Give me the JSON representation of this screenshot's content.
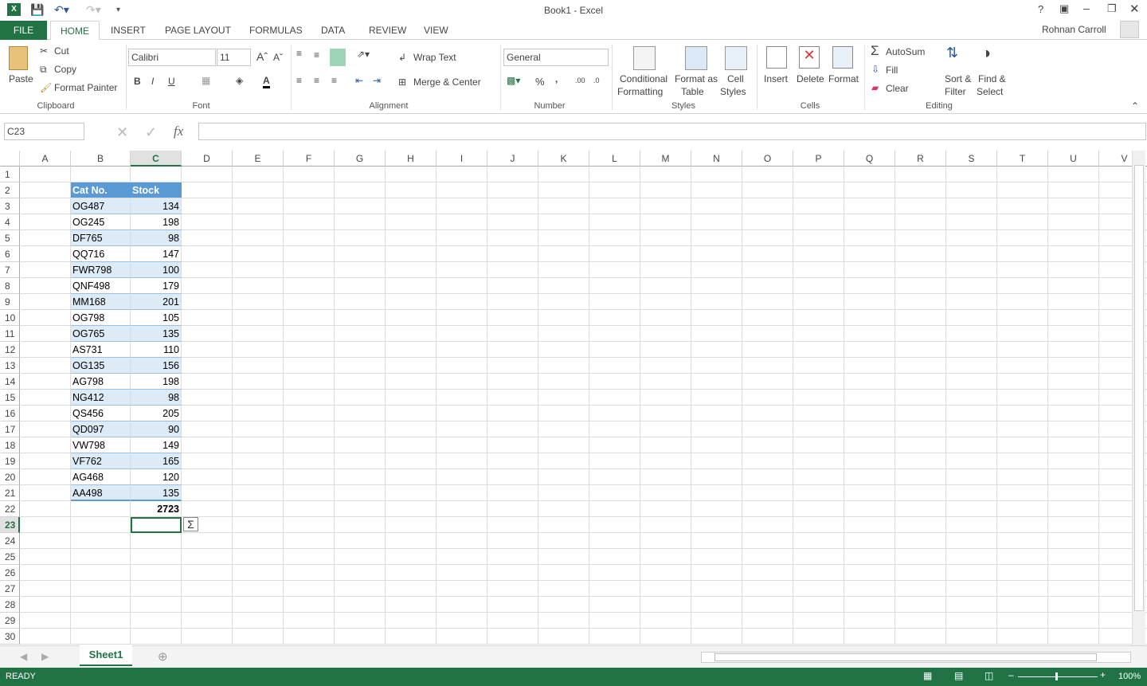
{
  "window": {
    "title": "Book1 - Excel",
    "user": "Rohnan Carroll",
    "help": "?"
  },
  "tabs": [
    {
      "label": "FILE"
    },
    {
      "label": "HOME"
    },
    {
      "label": "INSERT"
    },
    {
      "label": "PAGE LAYOUT"
    },
    {
      "label": "FORMULAS"
    },
    {
      "label": "DATA"
    },
    {
      "label": "REVIEW"
    },
    {
      "label": "VIEW"
    }
  ],
  "ribbon": {
    "clipboard": {
      "label": "Clipboard",
      "paste": "Paste",
      "cut": "Cut",
      "copy": "Copy",
      "format_painter": "Format Painter"
    },
    "font": {
      "label": "Font",
      "font_name": "Calibri",
      "font_size": "11",
      "bold": "B",
      "italic": "I",
      "underline": "U"
    },
    "alignment": {
      "label": "Alignment",
      "wrap_text": "Wrap Text",
      "merge_center": "Merge & Center"
    },
    "number": {
      "label": "Number",
      "format": "General",
      "percent": "%",
      "comma": ","
    },
    "styles": {
      "label": "Styles",
      "conditional": "Conditional",
      "conditional2": "Formatting",
      "format_as": "Format as",
      "format_as2": "Table",
      "cell": "Cell",
      "cell2": "Styles"
    },
    "cells": {
      "label": "Cells",
      "insert": "Insert",
      "delete": "Delete",
      "format": "Format"
    },
    "editing": {
      "label": "Editing",
      "autosum": "AutoSum",
      "fill": "Fill",
      "clear": "Clear",
      "sort": "Sort &",
      "sort2": "Filter",
      "find": "Find &",
      "find2": "Select"
    }
  },
  "formula_bar": {
    "name_box": "C23",
    "fx": "fx",
    "value": ""
  },
  "columns": [
    "A",
    "B",
    "C",
    "D",
    "E",
    "F",
    "G",
    "H",
    "I",
    "J",
    "K",
    "L",
    "M",
    "N",
    "O",
    "P",
    "Q",
    "R",
    "S",
    "T",
    "U",
    "V"
  ],
  "table": {
    "headers": [
      "Cat No.",
      "Stock"
    ],
    "rows": [
      [
        "OG487",
        "134"
      ],
      [
        "OG245",
        "198"
      ],
      [
        "DF765",
        "98"
      ],
      [
        "QQ716",
        "147"
      ],
      [
        "FWR798",
        "100"
      ],
      [
        "QNF498",
        "179"
      ],
      [
        "MM168",
        "201"
      ],
      [
        "OG798",
        "105"
      ],
      [
        "OG765",
        "135"
      ],
      [
        "AS731",
        "110"
      ],
      [
        "OG135",
        "156"
      ],
      [
        "AG798",
        "198"
      ],
      [
        "NG412",
        "98"
      ],
      [
        "QS456",
        "205"
      ],
      [
        "QD097",
        "90"
      ],
      [
        "VW798",
        "149"
      ],
      [
        "VF762",
        "165"
      ],
      [
        "AG468",
        "120"
      ],
      [
        "AA498",
        "135"
      ]
    ],
    "total": "2723",
    "header_color": "#5b9bd5",
    "band_color": "#ddebf7"
  },
  "selected_cell": "C23",
  "sheets": [
    {
      "label": "Sheet1"
    }
  ],
  "status": {
    "text": "READY",
    "zoom": "100%"
  },
  "accent": "#217346"
}
